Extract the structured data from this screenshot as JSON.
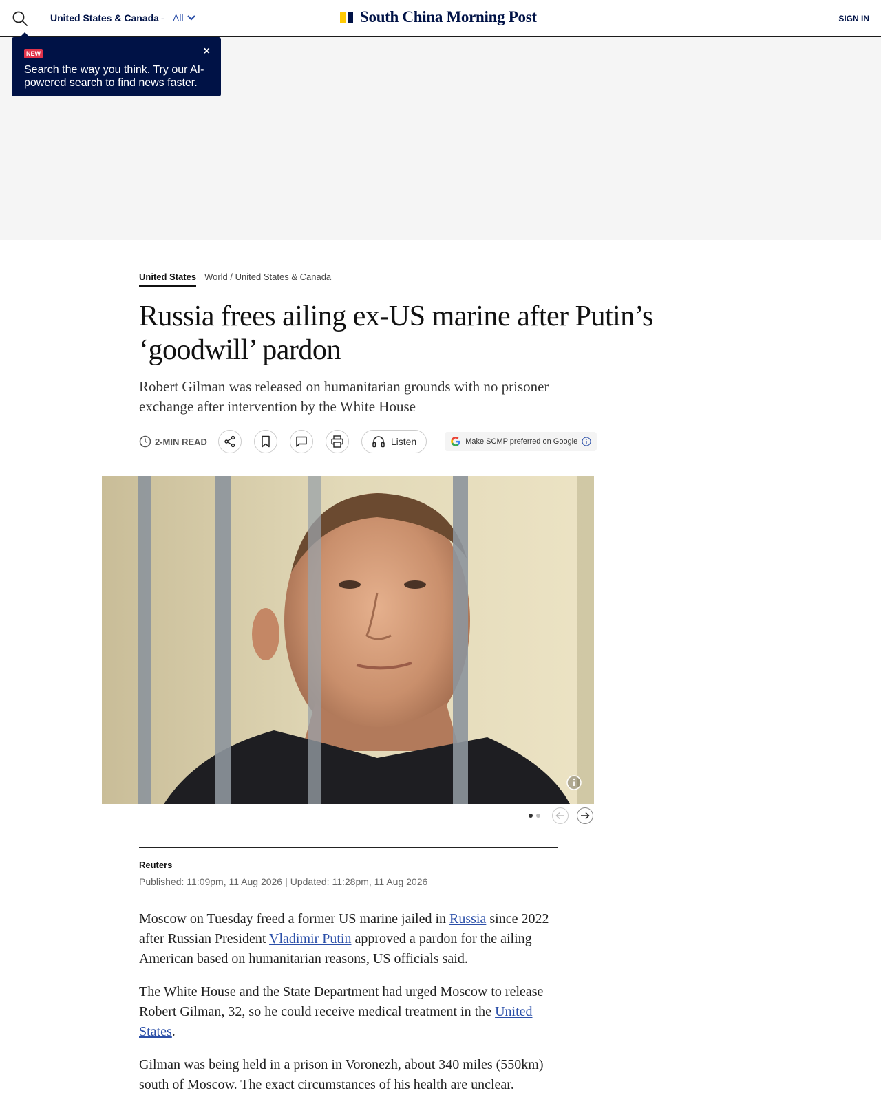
{
  "header": {
    "edition": "United States & Canada",
    "separator": "-",
    "edition_filter": "All",
    "site_name": "South China Morning Post",
    "sign_in": "SIGN IN"
  },
  "tooltip": {
    "badge": "NEW",
    "text": "Search the way you think. Try our AI-powered search to find news faster.",
    "close": "×"
  },
  "breadcrumb": {
    "topic": "United States",
    "section": "World",
    "divider": "/",
    "subsection": "United States & Canada"
  },
  "article": {
    "headline": "Russia frees ailing ex-US marine after Putin’s ‘goodwill’ pardon",
    "subhead": "Robert Gilman was released on humanitarian grounds with no prisoner exchange after intervention by the White House",
    "read_time": "2-MIN READ",
    "listen": "Listen",
    "google_pref": "Make SCMP preferred on Google",
    "source": "Reuters",
    "published": "Published: 11:09pm, 11 Aug 2026",
    "date_sep": "|",
    "updated": "Updated: 11:28pm, 11 Aug 2026",
    "p1_a": "Moscow on Tuesday freed a former US marine jailed in ",
    "p1_link1": "Russia",
    "p1_b": " since 2022 after Russian President ",
    "p1_link2": "Vladimir Putin",
    "p1_c": " approved a pardon for the ailing American based on humanitarian reasons, US officials said.",
    "p2_a": "The White House and the State Department had urged Moscow to release Robert Gilman, 32, so he could receive medical treatment in the ",
    "p2_link": "United States",
    "p2_b": ".",
    "p3": "Gilman was being held in a prison in Voronezh, about 340 miles (550km) south of Moscow. The exact circumstances of his health are unclear."
  },
  "carousel": {
    "total": 2,
    "current": 1
  },
  "colors": {
    "brand_navy": "#001246",
    "brand_yellow": "#ffca05",
    "link_blue": "#2b4fa8",
    "badge_red": "#e1334b"
  }
}
